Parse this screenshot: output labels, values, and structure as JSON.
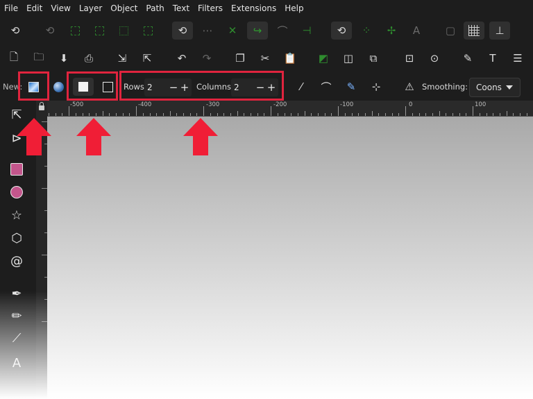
{
  "menu": [
    "File",
    "Edit",
    "View",
    "Layer",
    "Object",
    "Path",
    "Text",
    "Filters",
    "Extensions",
    "Help"
  ],
  "mesh_toolbar": {
    "new_label": "New:",
    "rows_label": "Rows:",
    "rows_value": "2",
    "columns_label": "Columns:",
    "columns_value": "2",
    "smoothing_label": "Smoothing:",
    "smoothing_value": "Coons",
    "minus": "−",
    "plus": "+"
  },
  "ruler_labels": [
    "-500",
    "-400",
    "-300",
    "-200",
    "-100",
    "0",
    "100"
  ],
  "colors": {
    "highlight": "#e0243e",
    "arrow": "#f01e36",
    "toolbar_bg": "#1d1d1d"
  },
  "icons": {
    "toolbar1": [
      "snap-toggle-icon",
      "snap-bbox-icon",
      "snap-bbox-edge-icon",
      "snap-bbox-corner-icon",
      "snap-bbox-center-icon",
      "snap-bbox-midpoint-icon",
      "snap-nodes-icon",
      "snap-path-icon",
      "snap-intersection-icon",
      "snap-smooth-icon",
      "snap-cusp-icon",
      "snap-line-midpoint-icon",
      "snap-others-icon",
      "snap-object-center-icon",
      "snap-rotation-center-icon",
      "snap-text-baseline-icon",
      "snap-page-border-icon",
      "snap-grid-icon",
      "snap-guide-icon"
    ],
    "toolbar2": [
      "new-document-icon",
      "open-file-icon",
      "save-icon",
      "print-icon",
      "import-icon",
      "export-icon",
      "undo-icon",
      "redo-icon",
      "duplicate-icon",
      "cut-icon",
      "paste-icon",
      "group-icon",
      "ungroup-icon",
      "clone-icon",
      "zoom-selection-icon",
      "zoom-drawing-icon",
      "xml-editor-icon",
      "text-font-icon",
      "align-distribute-icon"
    ]
  }
}
